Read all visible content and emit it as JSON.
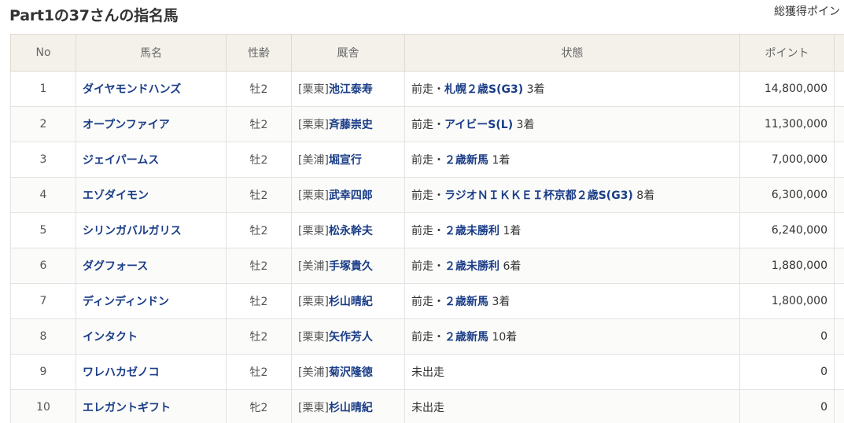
{
  "page_title": "Part1の37さんの指名馬",
  "total_points_label": "総獲得ポイン",
  "columns": {
    "no": "No",
    "name": "馬名",
    "sexage": "性齢",
    "stable": "厩舎",
    "status": "状態",
    "points": "ポイント"
  },
  "rows": [
    {
      "no": "1",
      "name": "ダイヤモンドハンズ",
      "sexage": "牡2",
      "stable_loc": "[栗東]",
      "trainer": "池江泰寿",
      "status_prefix": "前走・",
      "race": "札幌２歳S(G3)",
      "finish": " 3着",
      "points": "14,800,000"
    },
    {
      "no": "2",
      "name": "オープンファイア",
      "sexage": "牡2",
      "stable_loc": "[栗東]",
      "trainer": "斉藤崇史",
      "status_prefix": "前走・",
      "race": "アイビーS(L)",
      "finish": " 3着",
      "points": "11,300,000"
    },
    {
      "no": "3",
      "name": "ジェイパームス",
      "sexage": "牡2",
      "stable_loc": "[美浦]",
      "trainer": "堀宣行",
      "status_prefix": "前走・",
      "race": "２歳新馬",
      "finish": " 1着",
      "points": "7,000,000"
    },
    {
      "no": "4",
      "name": "エゾダイモン",
      "sexage": "牡2",
      "stable_loc": "[栗東]",
      "trainer": "武幸四郎",
      "status_prefix": "前走・",
      "race": "ラジオＮＩＫＫＥＩ杯京都２歳S(G3)",
      "finish": " 8着",
      "points": "6,300,000"
    },
    {
      "no": "5",
      "name": "シリンガバルガリス",
      "sexage": "牡2",
      "stable_loc": "[栗東]",
      "trainer": "松永幹夫",
      "status_prefix": "前走・",
      "race": "２歳未勝利",
      "finish": " 1着",
      "points": "6,240,000"
    },
    {
      "no": "6",
      "name": "ダグフォース",
      "sexage": "牡2",
      "stable_loc": "[美浦]",
      "trainer": "手塚貴久",
      "status_prefix": "前走・",
      "race": "２歳未勝利",
      "finish": " 6着",
      "points": "1,880,000"
    },
    {
      "no": "7",
      "name": "ディンディンドン",
      "sexage": "牡2",
      "stable_loc": "[栗東]",
      "trainer": "杉山晴紀",
      "status_prefix": "前走・",
      "race": "２歳新馬",
      "finish": " 3着",
      "points": "1,800,000"
    },
    {
      "no": "8",
      "name": "インタクト",
      "sexage": "牡2",
      "stable_loc": "[栗東]",
      "trainer": "矢作芳人",
      "status_prefix": "前走・",
      "race": "２歳新馬",
      "finish": " 10着",
      "points": "0"
    },
    {
      "no": "9",
      "name": "ワレハカゼノコ",
      "sexage": "牡2",
      "stable_loc": "[美浦]",
      "trainer": "菊沢隆徳",
      "status_text": "未出走",
      "points": "0"
    },
    {
      "no": "10",
      "name": "エレガントギフト",
      "sexage": "牝2",
      "stable_loc": "[栗東]",
      "trainer": "杉山晴紀",
      "status_text": "未出走",
      "points": "0"
    }
  ],
  "colors": {
    "link": "#1a3d87",
    "header_bg": "#f4f1ea",
    "border": "#e3e3e3"
  }
}
